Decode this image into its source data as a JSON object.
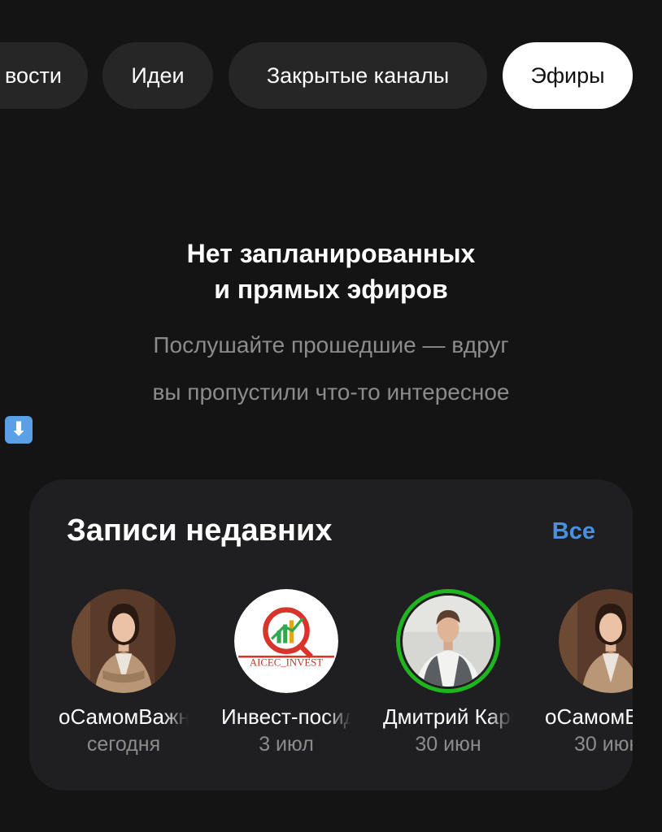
{
  "tabs": [
    {
      "label": "Новости",
      "visible_label": "вости",
      "active": false
    },
    {
      "label": "Идеи",
      "active": false
    },
    {
      "label": "Закрытые каналы",
      "active": false
    },
    {
      "label": "Эфиры",
      "active": true
    }
  ],
  "empty_state": {
    "title_line1": "Нет запланированных",
    "title_line2": "и прямых эфиров",
    "subtitle_line1": "Послушайте прошедшие — вдруг",
    "subtitle_line2": "вы пропустили что-то интересное",
    "emoji": "⬇"
  },
  "recordings": {
    "title": "Записи недавних",
    "all_label": "Все",
    "items": [
      {
        "name": "оСамомВажном",
        "date": "сегодня",
        "avatar": "woman-portrait",
        "live": false
      },
      {
        "name": "Инвест-посиделки",
        "date": "3 июл",
        "avatar": "aicec-invest-logo",
        "logo_text": "AICEC_INVEST",
        "live": false
      },
      {
        "name": "Дмитрий Карпов",
        "date": "30 июн",
        "avatar": "man-portrait",
        "live": true
      },
      {
        "name": "оСамомВажном",
        "date": "30 июн",
        "avatar": "woman-portrait",
        "live": false
      }
    ]
  },
  "colors": {
    "background": "#141414",
    "card": "#1f1f21",
    "tab": "#262626",
    "accent_link": "#4a90e2",
    "live_ring": "#1fb51f",
    "muted_text": "#8c8c8c"
  }
}
